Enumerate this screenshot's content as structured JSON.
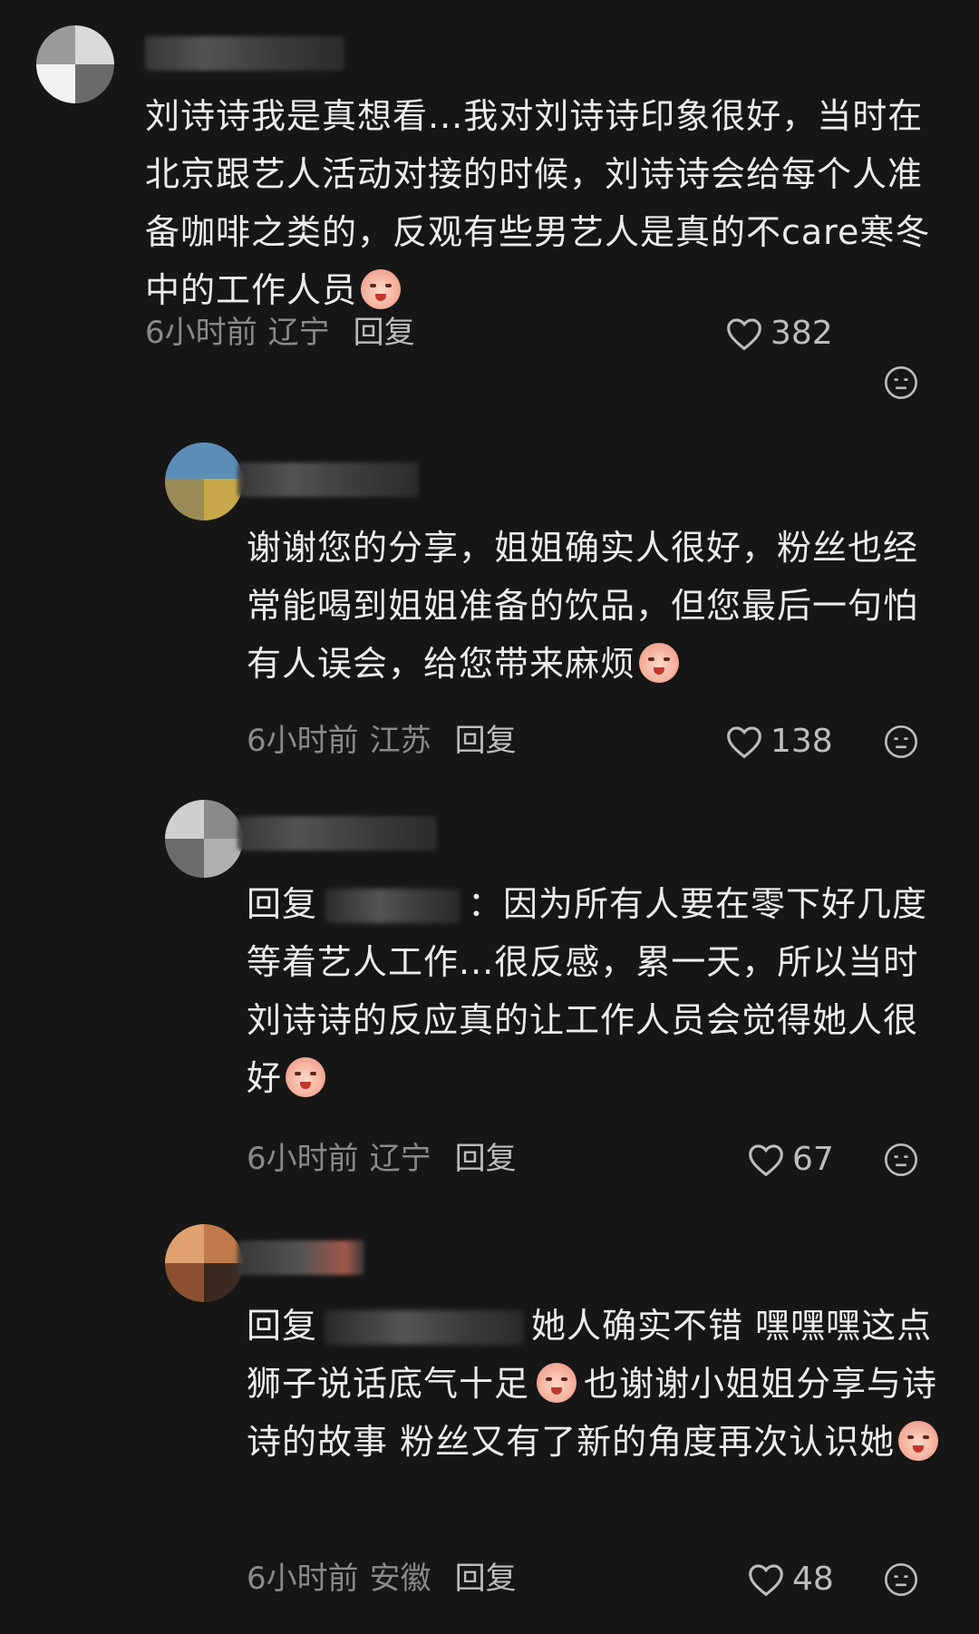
{
  "comments": [
    {
      "text": "刘诗诗我是真想看...我对刘诗诗印象很好，当时在北京跟艺人活动对接的时候，刘诗诗会给每个人准备咖啡之类的，反观有些男艺人是真的不care寒冬中的工作人员",
      "emoji": "crying-face-emoji",
      "time": "6小时前",
      "location": "辽宁",
      "reply_label": "回复",
      "likes": "382"
    },
    {
      "text": "谢谢您的分享，姐姐确实人很好，粉丝也经常能喝到姐姐准备的饮品，但您最后一句怕有人误会，给您带来麻烦",
      "emoji": "tearful-face-emoji",
      "time": "6小时前",
      "location": "江苏",
      "reply_label": "回复",
      "likes": "138"
    },
    {
      "reply_prefix": "回复",
      "text_after": "：因为所有人要在零下好几度等着艺人工作...很反感，累一天，所以当时刘诗诗的反应真的让工作人员会觉得她人很好",
      "emoji": "crying-face-emoji",
      "time": "6小时前",
      "location": "辽宁",
      "reply_label": "回复",
      "likes": "67"
    },
    {
      "reply_prefix": "回复",
      "text_after": "她人确实不错 嘿嘿嘿这点狮子说话底气十足",
      "emoji_mid": "laughing-face-emoji",
      "text_after2": "也谢谢小姐姐分享与诗诗的故事 粉丝又有了新的角度再次认识她",
      "emoji": "kiss-face-emoji",
      "time": "6小时前",
      "location": "安徽",
      "reply_label": "回复",
      "likes": "48"
    }
  ],
  "colors": {
    "background": "#161616",
    "text": "#ececec",
    "meta": "#8a8a8a"
  }
}
